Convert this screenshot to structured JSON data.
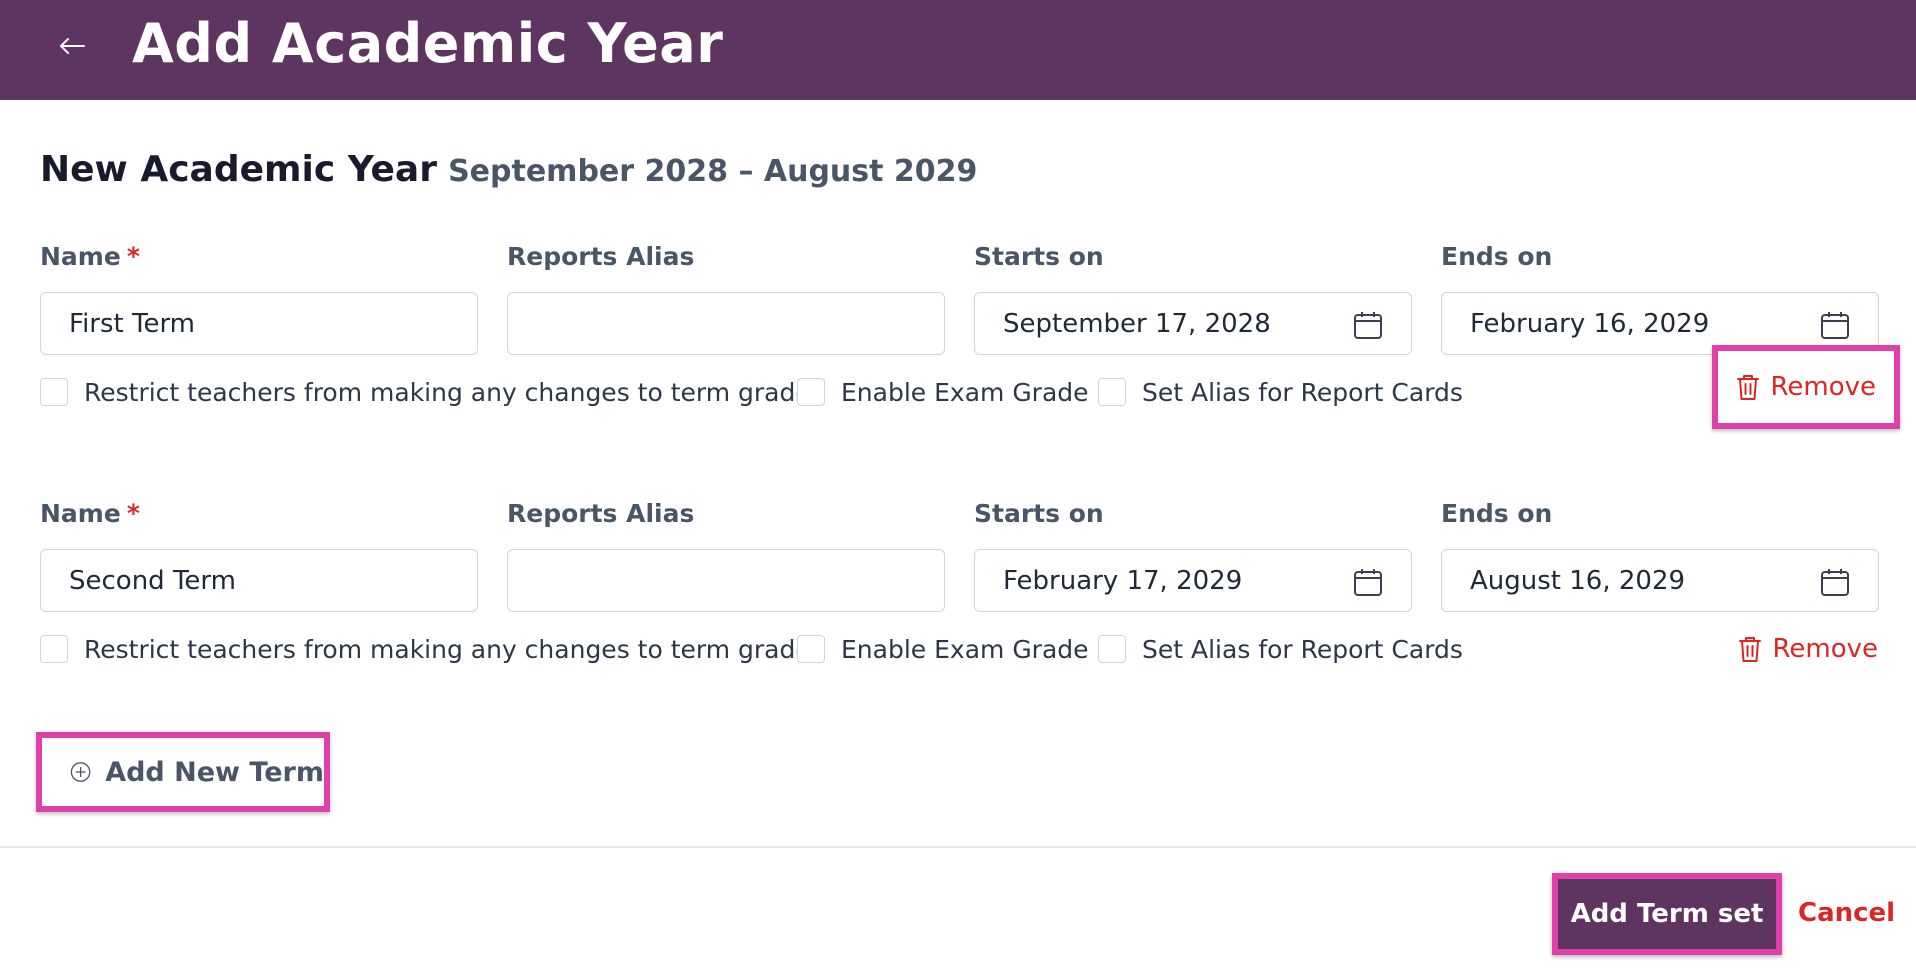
{
  "header": {
    "title": "Add Academic Year",
    "background_color": "#5e3461",
    "back_icon": "arrow-left-icon"
  },
  "subheading": {
    "title": "New Academic Year",
    "date_range": "September 2028 – August 2029"
  },
  "labels": {
    "name": "Name",
    "required_mark": "*",
    "reports_alias": "Reports Alias",
    "starts_on": "Starts on",
    "ends_on": "Ends on",
    "restrict_teachers": "Restrict teachers from making any changes to term grades",
    "enable_exam_grade": "Enable Exam Grade",
    "set_alias": "Set Alias for Report Cards",
    "remove": "Remove"
  },
  "terms": [
    {
      "name": "First Term",
      "reports_alias": "",
      "starts_on": "September 17, 2028",
      "ends_on": "February 16, 2029",
      "restrict_teachers": false,
      "enable_exam_grade": false,
      "set_alias": false
    },
    {
      "name": "Second Term",
      "reports_alias": "",
      "starts_on": "February 17, 2029",
      "ends_on": "August 16, 2029",
      "restrict_teachers": false,
      "enable_exam_grade": false,
      "set_alias": false
    }
  ],
  "actions": {
    "add_new_term": "Add New Term",
    "submit": "Add Term set",
    "cancel": "Cancel"
  },
  "colors": {
    "brand": "#5e3461",
    "danger": "#dc2626",
    "highlight": "#e040a8"
  }
}
